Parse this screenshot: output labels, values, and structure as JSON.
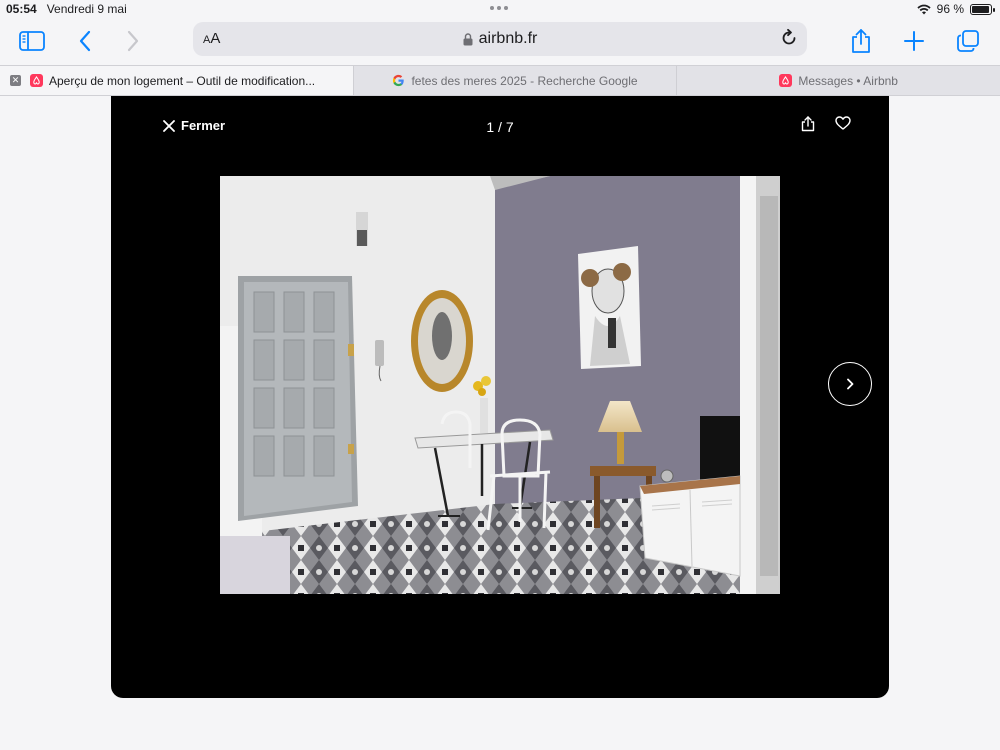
{
  "status": {
    "time": "05:54",
    "date": "Vendredi 9 mai",
    "battery": "96 %"
  },
  "toolbar": {
    "aa_label_small": "A",
    "aa_label_large": "A",
    "url": "airbnb.fr"
  },
  "tabs": [
    {
      "label": "Aperçu de mon logement – Outil de modification...",
      "favicon": "airbnb"
    },
    {
      "label": "fetes des meres 2025 - Recherche Google",
      "favicon": "google"
    },
    {
      "label": "Messages • Airbnb",
      "favicon": "airbnb"
    }
  ],
  "gallery": {
    "close_label": "Fermer",
    "counter": "1 / 7"
  },
  "colors": {
    "airbnb_brand": "#ff385c",
    "accent_blue": "#0a84ff",
    "wall_gray": "#807c8e"
  }
}
